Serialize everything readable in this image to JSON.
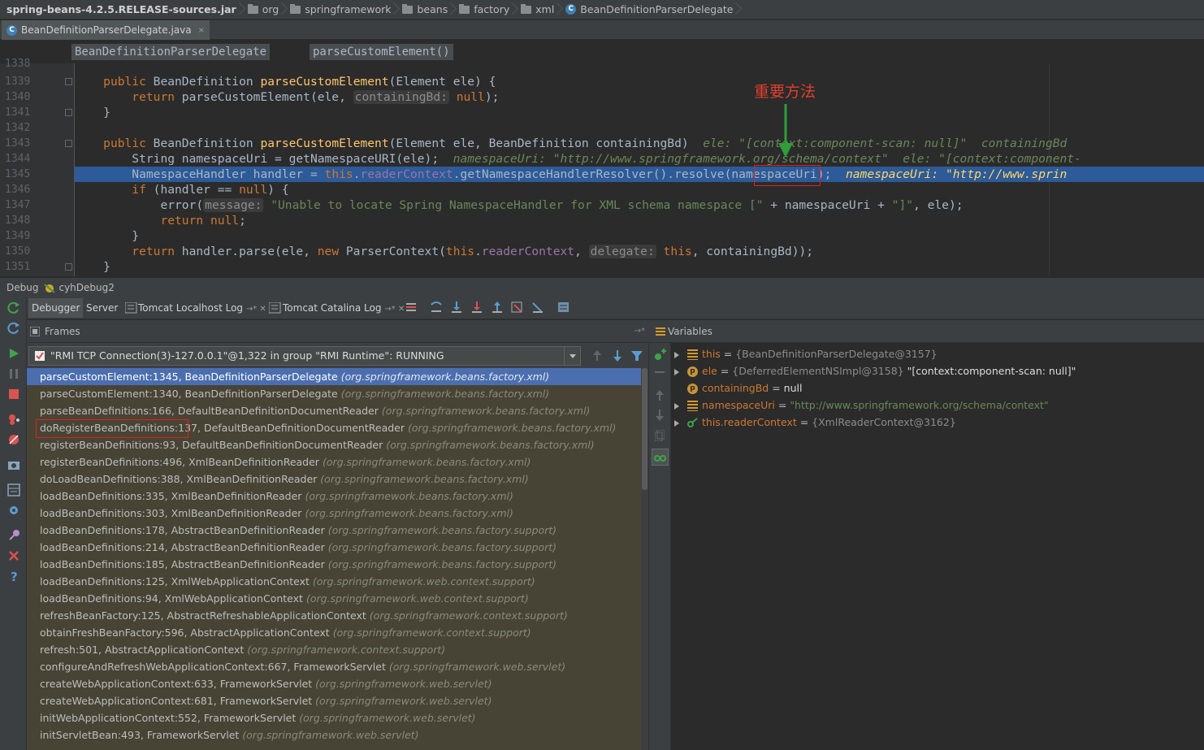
{
  "breadcrumb": [
    {
      "label": "spring-beans-4.2.5.RELEASE-sources.jar",
      "icon": "jar"
    },
    {
      "label": "org",
      "icon": "folder-icon"
    },
    {
      "label": "springframework",
      "icon": "folder-icon"
    },
    {
      "label": "beans",
      "icon": "folder-icon"
    },
    {
      "label": "factory",
      "icon": "folder-icon"
    },
    {
      "label": "xml",
      "icon": "folder-icon"
    },
    {
      "label": "BeanDefinitionParserDelegate",
      "icon": "class-icon"
    }
  ],
  "file_tab": {
    "label": "BeanDefinitionParserDelegate.java",
    "close": "×"
  },
  "editor": {
    "class_chip": "BeanDefinitionParserDelegate",
    "method_chip": "parseCustomElement()",
    "annotation": "重要方法",
    "line_numbers": [
      "1338",
      "1339",
      "1340",
      "1341",
      "1342",
      "1343",
      "1344",
      "1345",
      "1346",
      "1347",
      "1348",
      "1349",
      "1350",
      "1351"
    ],
    "lines": {
      "l1339": {
        "k1": "public",
        "t1": " BeanDefinition ",
        "f1": "parseCustomElement",
        "t2": "(Element ele) {"
      },
      "l1340": {
        "k1": "return",
        "t1": " parseCustomElement(ele, ",
        "h1": "containingBd:",
        "k2": " null",
        "t2": ");"
      },
      "l1341": {
        "t1": "}"
      },
      "l1343": {
        "k1": "public",
        "t1": " BeanDefinition ",
        "f1": "parseCustomElement",
        "t2": "(Element ele, BeanDefinition containingBd)",
        "i1": "  ele: \"[context:component-scan: null]\"  containingBd"
      },
      "l1344": {
        "t1": "String namespaceUri = getNamespaceURI(ele);",
        "i1": "  namespaceUri: \"http://www.springframework.org/schema/context\"  ele: \"[context:component-"
      },
      "l1345": {
        "t1": "NamespaceHandler handler = ",
        "k1": "this",
        "t2": ".",
        "fl1": "readerContext",
        "t3": ".getNamespaceHandlerResolver().resolve(namespaceUri);",
        "i1": "  namespaceUri: \"http://www.sprin"
      },
      "l1346": {
        "k1": "if",
        "t1": " (handler == ",
        "k2": "null",
        "t2": ") {"
      },
      "l1347": {
        "t1": "error(",
        "h1": "message:",
        "s1": " \"Unable to locate Spring NamespaceHandler for XML schema namespace [\"",
        "t2": " + namespaceUri + ",
        "s2": "\"]\"",
        "t3": ", ele);"
      },
      "l1348": {
        "k1": "return null",
        "t1": ";"
      },
      "l1349": {
        "t1": "}"
      },
      "l1350": {
        "k1": "return",
        "t1": " handler.parse(ele, ",
        "k2": "new",
        "t2": " ParserContext(",
        "k3": "this",
        "t3": ".",
        "fl1": "readerContext",
        "t4": ", ",
        "h1": "delegate:",
        "k4": " this",
        "t5": ", containingBd));"
      },
      "l1351": {
        "t1": "}"
      }
    }
  },
  "debug": {
    "title": "Debug",
    "config": "cyhDebug2",
    "tabs": [
      "Debugger",
      "Server",
      "Tomcat Localhost Log",
      "Tomcat Catalina Log"
    ],
    "frames_title": "Frames",
    "variables_title": "Variables",
    "thread": "\"RMI TCP Connection(3)-127.0.0.1\"@1,322 in group \"RMI Runtime\": RUNNING",
    "frames": [
      {
        "m": "parseCustomElement:1345, BeanDefinitionParserDelegate",
        "p": "(org.springframework.beans.factory.xml)"
      },
      {
        "m": "parseCustomElement:1340, BeanDefinitionParserDelegate",
        "p": "(org.springframework.beans.factory.xml)"
      },
      {
        "m": "parseBeanDefinitions:166, DefaultBeanDefinitionDocumentReader",
        "p": "(org.springframework.beans.factory.xml)"
      },
      {
        "m": "doRegisterBeanDefinitions:137, DefaultBeanDefinitionDocumentReader",
        "p": "(org.springframework.beans.factory.xml)"
      },
      {
        "m": "registerBeanDefinitions:93, DefaultBeanDefinitionDocumentReader",
        "p": "(org.springframework.beans.factory.xml)"
      },
      {
        "m": "registerBeanDefinitions:496, XmlBeanDefinitionReader",
        "p": "(org.springframework.beans.factory.xml)"
      },
      {
        "m": "doLoadBeanDefinitions:388, XmlBeanDefinitionReader",
        "p": "(org.springframework.beans.factory.xml)"
      },
      {
        "m": "loadBeanDefinitions:335, XmlBeanDefinitionReader",
        "p": "(org.springframework.beans.factory.xml)"
      },
      {
        "m": "loadBeanDefinitions:303, XmlBeanDefinitionReader",
        "p": "(org.springframework.beans.factory.xml)"
      },
      {
        "m": "loadBeanDefinitions:178, AbstractBeanDefinitionReader",
        "p": "(org.springframework.beans.factory.support)"
      },
      {
        "m": "loadBeanDefinitions:214, AbstractBeanDefinitionReader",
        "p": "(org.springframework.beans.factory.support)"
      },
      {
        "m": "loadBeanDefinitions:185, AbstractBeanDefinitionReader",
        "p": "(org.springframework.beans.factory.support)"
      },
      {
        "m": "loadBeanDefinitions:125, XmlWebApplicationContext",
        "p": "(org.springframework.web.context.support)"
      },
      {
        "m": "loadBeanDefinitions:94, XmlWebApplicationContext",
        "p": "(org.springframework.web.context.support)"
      },
      {
        "m": "refreshBeanFactory:125, AbstractRefreshableApplicationContext",
        "p": "(org.springframework.context.support)"
      },
      {
        "m": "obtainFreshBeanFactory:596, AbstractApplicationContext",
        "p": "(org.springframework.context.support)"
      },
      {
        "m": "refresh:501, AbstractApplicationContext",
        "p": "(org.springframework.context.support)"
      },
      {
        "m": "configureAndRefreshWebApplicationContext:667, FrameworkServlet",
        "p": "(org.springframework.web.servlet)"
      },
      {
        "m": "createWebApplicationContext:633, FrameworkServlet",
        "p": "(org.springframework.web.servlet)"
      },
      {
        "m": "createWebApplicationContext:681, FrameworkServlet",
        "p": "(org.springframework.web.servlet)"
      },
      {
        "m": "initWebApplicationContext:552, FrameworkServlet",
        "p": "(org.springframework.web.servlet)"
      },
      {
        "m": "initServletBean:493, FrameworkServlet",
        "p": "(org.springframework.web.servlet)"
      }
    ],
    "variables": [
      {
        "name": "this",
        "eq": " = ",
        "val": "{BeanDefinitionParserDelegate@3157}",
        "str": "",
        "icon": "field-icon",
        "expand": true
      },
      {
        "name": "ele",
        "eq": " = ",
        "val": "{DeferredElementNSImpl@3158}",
        "str": " \"[context:component-scan: null]\"",
        "icon": "param-icon",
        "expand": true
      },
      {
        "name": "containingBd",
        "eq": " = ",
        "val": "null",
        "str": "",
        "icon": "param-icon",
        "expand": false
      },
      {
        "name": "namespaceUri",
        "eq": " = ",
        "val": "",
        "str": "\"http://www.springframework.org/schema/context\"",
        "icon": "field-icon",
        "expand": true
      },
      {
        "name": "this.readerContext",
        "eq": " = ",
        "val": "{XmlReaderContext@3162}",
        "str": "",
        "icon": "watch-icon",
        "expand": true
      }
    ]
  }
}
